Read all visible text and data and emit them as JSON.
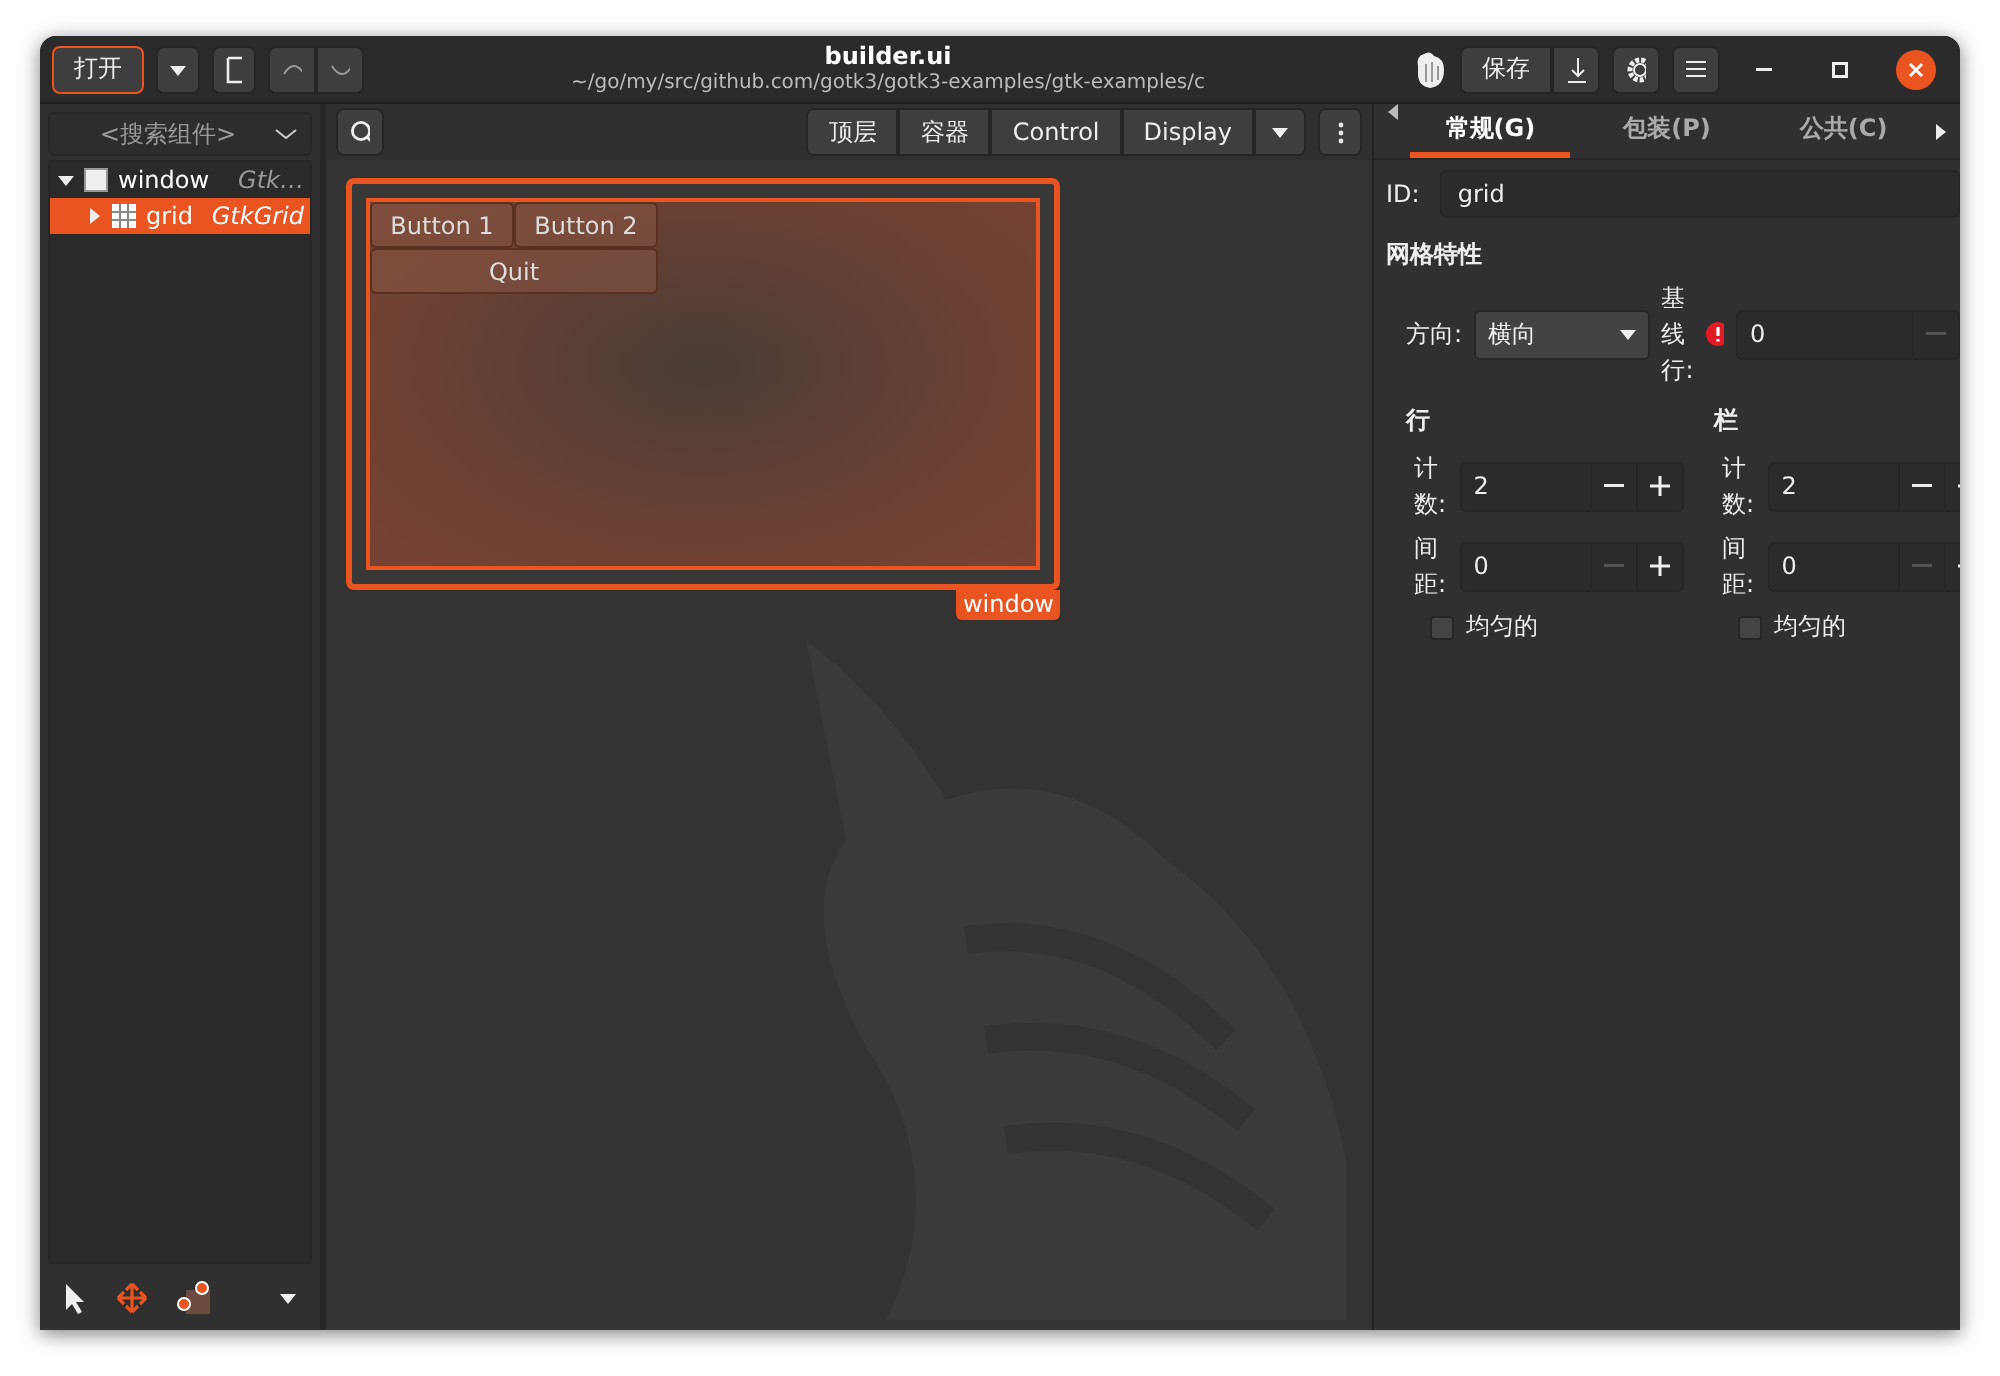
{
  "window": {
    "title": "builder.ui",
    "subtitle": "~/go/my/src/github.com/gotk3/gotk3-examples/gtk-examples/c"
  },
  "header": {
    "open_button": "打开",
    "save_button": "保存"
  },
  "sidebar": {
    "search": {
      "placeholder": "<搜索组件>"
    },
    "tree": [
      {
        "kind": "window",
        "name": "window",
        "type": "Gtk…",
        "expanded": true,
        "selected": false,
        "children": [
          {
            "kind": "grid",
            "name": "grid",
            "type": "GtkGrid",
            "expanded": false,
            "selected": true
          }
        ]
      }
    ]
  },
  "toolbar": {
    "tabs": [
      "顶层",
      "容器",
      "Control",
      "Display"
    ]
  },
  "canvas": {
    "buttons": [
      {
        "label": "Button 1",
        "wide": false
      },
      {
        "label": "Button 2",
        "wide": false
      },
      {
        "label": "Quit",
        "wide": true
      }
    ],
    "window_label": "window"
  },
  "inspector": {
    "tabs": [
      {
        "label": "常规(G)",
        "selected": true
      },
      {
        "label": "包装(P)",
        "selected": false
      },
      {
        "label": "公共(C)",
        "selected": false
      }
    ],
    "id_label": "ID:",
    "id_value": "grid",
    "section": "网格特性",
    "orientation_label": "方向:",
    "orientation_value": "横向",
    "baseline_label": "基线行:",
    "baseline_value": "0",
    "baseline_error": true,
    "groups": [
      {
        "title": "行",
        "count_label": "计数:",
        "count": "2",
        "count_minus_disabled": false,
        "spacing_label": "间距:",
        "spacing": "0",
        "spacing_minus_disabled": true,
        "homogeneous_label": "均匀的",
        "homogeneous": false
      },
      {
        "title": "栏",
        "count_label": "计数:",
        "count": "2",
        "count_minus_disabled": false,
        "spacing_label": "间距:",
        "spacing": "0",
        "spacing_minus_disabled": true,
        "homogeneous_label": "均匀的",
        "homogeneous": false
      }
    ]
  }
}
